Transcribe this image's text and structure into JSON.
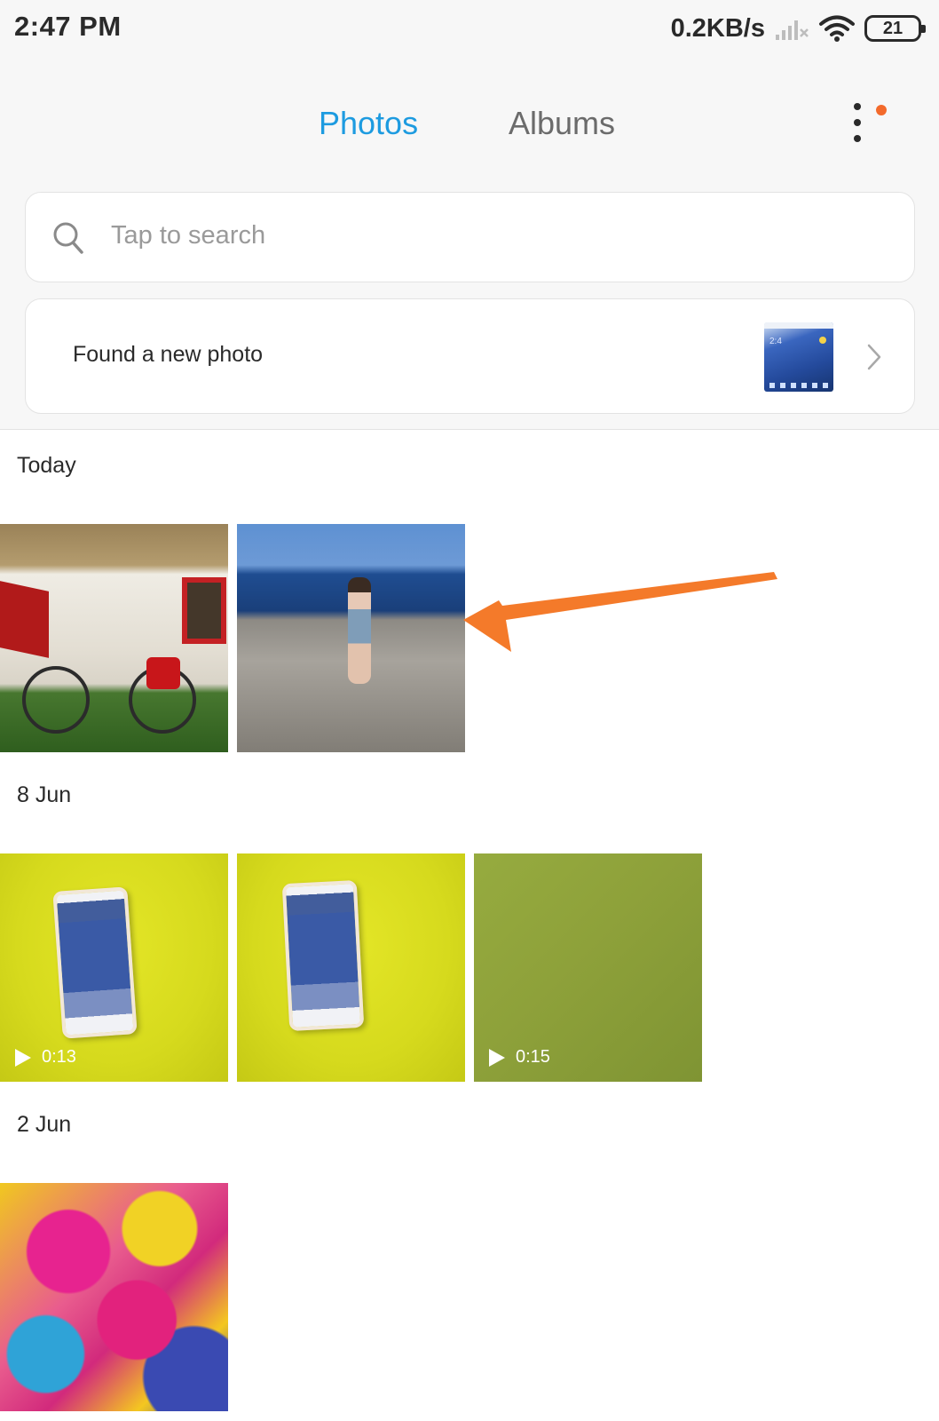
{
  "status_bar": {
    "time": "2:47 PM",
    "net_speed": "0.2KB/s",
    "battery_level": "21",
    "signal_icon": "signal-off-icon",
    "wifi_icon": "wifi-icon"
  },
  "tabs": [
    {
      "label": "Photos",
      "active": true
    },
    {
      "label": "Albums",
      "active": false
    }
  ],
  "search": {
    "placeholder": "Tap to search"
  },
  "new_photo_card": {
    "label": "Found a new photo",
    "thumbnail_clock": "2:4"
  },
  "sections": [
    {
      "header": "Today",
      "items": [
        {
          "kind": "photo",
          "subject": "cottage-bicycle"
        },
        {
          "kind": "photo",
          "subject": "woman-on-rocks"
        }
      ]
    },
    {
      "header": "8 Jun",
      "items": [
        {
          "kind": "video",
          "duration": "0:13"
        },
        {
          "kind": "photo",
          "subject": "phone-on-yellow"
        },
        {
          "kind": "video",
          "duration": "0:15"
        }
      ]
    },
    {
      "header": "2 Jun",
      "items": [
        {
          "kind": "photo",
          "subject": "colorful-fabric"
        }
      ]
    }
  ],
  "colors": {
    "accent": "#1d9be0",
    "badge": "#f36a2b",
    "annotation_arrow": "#f47a2a"
  }
}
